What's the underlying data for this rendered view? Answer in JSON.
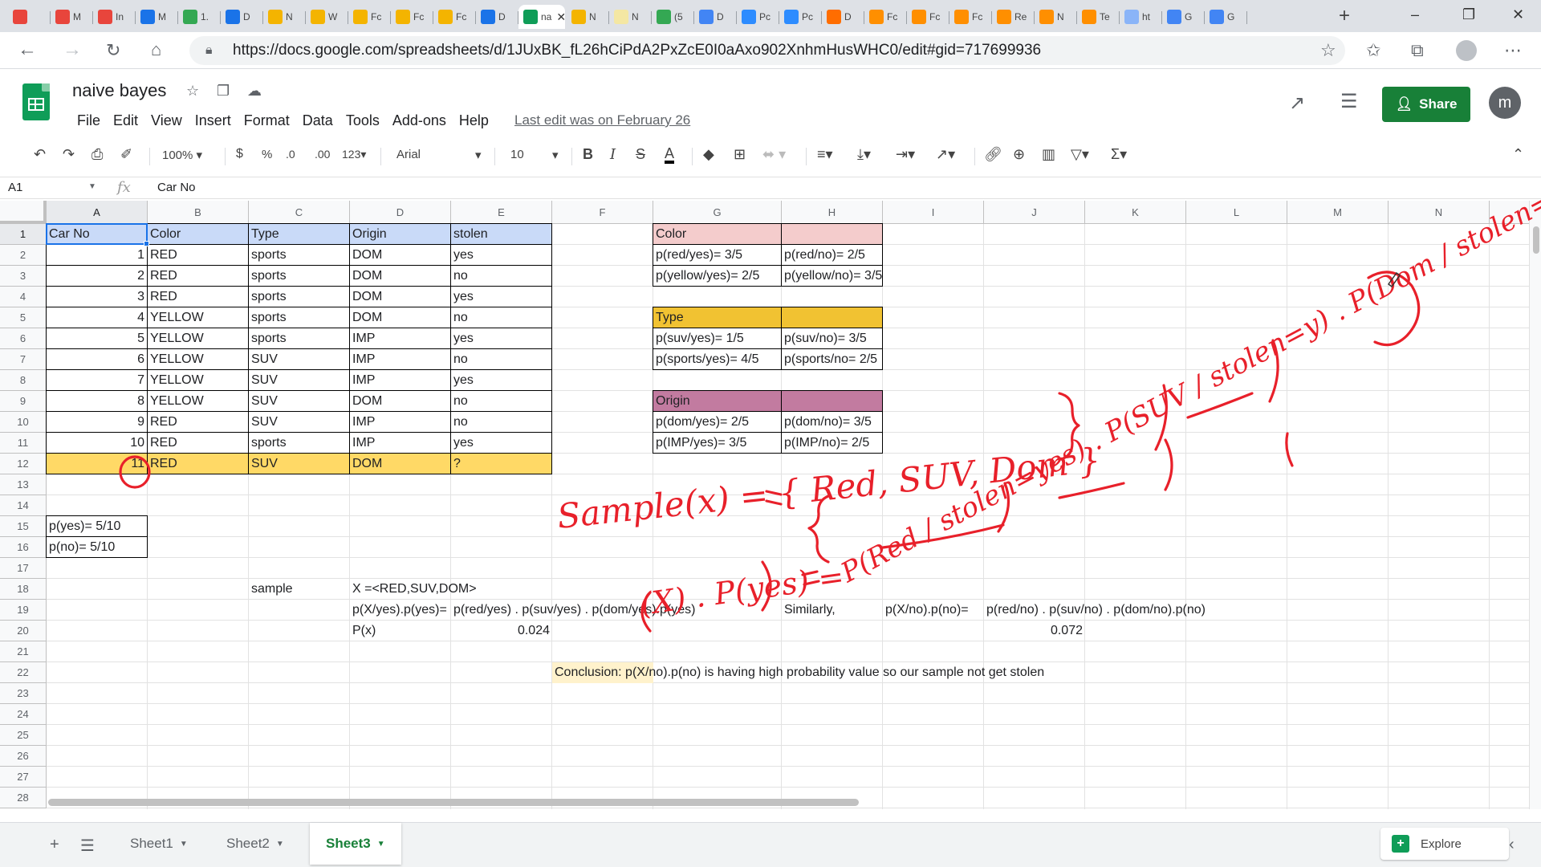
{
  "browser": {
    "tabs": [
      {
        "label": "",
        "color": "#e8453c",
        "icon": "gmail-icon"
      },
      {
        "label": "M",
        "color": "#e8453c",
        "icon": "gmail-icon"
      },
      {
        "label": "In",
        "color": "#e8453c",
        "icon": "gmail-icon"
      },
      {
        "label": "M",
        "color": "#1a73e8",
        "icon": "drive-icon"
      },
      {
        "label": "1.",
        "color": "#34a853",
        "icon": "plus-app-icon"
      },
      {
        "label": "D",
        "color": "#1a73e8",
        "icon": "drive-icon"
      },
      {
        "label": "N",
        "color": "#f4b400",
        "icon": "slides-icon"
      },
      {
        "label": "W",
        "color": "#f4b400",
        "icon": "slides-icon"
      },
      {
        "label": "Fc",
        "color": "#f4b400",
        "icon": "slides-icon"
      },
      {
        "label": "Fc",
        "color": "#f4b400",
        "icon": "slides-icon"
      },
      {
        "label": "Fc",
        "color": "#f4b400",
        "icon": "slides-icon"
      },
      {
        "label": "D",
        "color": "#1a73e8",
        "icon": "drive-icon"
      },
      {
        "label": "na",
        "color": "#0f9d58",
        "icon": "sheets-icon",
        "active": true
      },
      {
        "label": "N",
        "color": "#f4b400",
        "icon": "slides-icon"
      },
      {
        "label": "N",
        "color": "#f4e7a3",
        "icon": "keep-icon"
      },
      {
        "label": "(5",
        "color": "#34a853",
        "icon": "badge-icon"
      },
      {
        "label": "D",
        "color": "#4285f4",
        "icon": "link-icon"
      },
      {
        "label": "Pc",
        "color": "#2d8cff",
        "icon": "zoom-icon"
      },
      {
        "label": "Pc",
        "color": "#2d8cff",
        "icon": "zoom-icon"
      },
      {
        "label": "D",
        "color": "#ff6d00",
        "icon": "circle-icon"
      },
      {
        "label": "Fc",
        "color": "#ff8f00",
        "icon": "book-icon"
      },
      {
        "label": "Fc",
        "color": "#ff8f00",
        "icon": "book-icon"
      },
      {
        "label": "Fc",
        "color": "#ff8f00",
        "icon": "book-icon"
      },
      {
        "label": "Re",
        "color": "#ff8f00",
        "icon": "book-icon"
      },
      {
        "label": "N",
        "color": "#ff8f00",
        "icon": "book-icon"
      },
      {
        "label": "Te",
        "color": "#ff8f00",
        "icon": "book-icon"
      },
      {
        "label": "ht",
        "color": "#8ab4f8",
        "icon": "globe-icon"
      },
      {
        "label": "G",
        "color": "#4285f4",
        "icon": "google-icon"
      },
      {
        "label": "G",
        "color": "#4285f4",
        "icon": "google-icon"
      }
    ],
    "url": "https://docs.google.com/spreadsheets/d/1JUxBK_fL26hCiPdA2PxZcE0I0aAxo902XnhmHusWHC0/edit#gid=717699936"
  },
  "sheets": {
    "title": "naive bayes",
    "menu": [
      "File",
      "Edit",
      "View",
      "Insert",
      "Format",
      "Data",
      "Tools",
      "Add-ons",
      "Help"
    ],
    "last_edit": "Last edit was on February 26",
    "share_label": "Share",
    "avatar_letter": "m",
    "accent": "#188038"
  },
  "toolbar": {
    "zoom": "100%",
    "currency": "$",
    "percent": "%",
    "dec_less": ".0",
    "dec_more": ".00",
    "format_more": "123",
    "font": "Arial",
    "font_size": "10"
  },
  "formula_bar": {
    "cell_ref": "A1",
    "value": "Car No"
  },
  "grid": {
    "columns": [
      "A",
      "B",
      "C",
      "D",
      "E",
      "F",
      "G",
      "H",
      "I",
      "J",
      "K",
      "L",
      "M",
      "N"
    ],
    "rows": [
      "1",
      "2",
      "3",
      "4",
      "5",
      "6",
      "7",
      "8",
      "9",
      "10",
      "11",
      "12",
      "13",
      "14",
      "15",
      "16",
      "17",
      "18",
      "19",
      "20",
      "21",
      "22",
      "23",
      "24",
      "25",
      "26",
      "27",
      "28"
    ],
    "selected_cell": "A1",
    "header_fill": "#c9daf8",
    "highlight_fill": "#ffd966",
    "table": {
      "headers": [
        "Car No",
        "Color",
        "Type",
        "Origin",
        "stolen"
      ],
      "rows": [
        [
          "1",
          "RED",
          "sports",
          "DOM",
          "yes"
        ],
        [
          "2",
          "RED",
          "sports",
          "DOM",
          "no"
        ],
        [
          "3",
          "RED",
          "sports",
          "DOM",
          "yes"
        ],
        [
          "4",
          "YELLOW",
          "sports",
          "DOM",
          "no"
        ],
        [
          "5",
          "YELLOW",
          "sports",
          "IMP",
          "yes"
        ],
        [
          "6",
          "YELLOW",
          "SUV",
          "IMP",
          "no"
        ],
        [
          "7",
          "YELLOW",
          "SUV",
          "IMP",
          "yes"
        ],
        [
          "8",
          "YELLOW",
          "SUV",
          "DOM",
          "no"
        ],
        [
          "9",
          "RED",
          "SUV",
          "IMP",
          "no"
        ],
        [
          "10",
          "RED",
          "sports",
          "IMP",
          "yes"
        ],
        [
          "11",
          "RED",
          "SUV",
          "DOM",
          "?"
        ]
      ]
    },
    "priors": [
      "p(yes)= 5/10",
      "p(no)= 5/10"
    ],
    "color_table": {
      "title": "Color",
      "fill": "#f4cccc",
      "rows": [
        [
          "p(red/yes)= 3/5",
          "p(red/no)= 2/5"
        ],
        [
          "p(yellow/yes)= 2/5",
          "p(yellow/no)= 3/5"
        ]
      ]
    },
    "type_table": {
      "title": "Type",
      "fill": "#f1c232",
      "rows": [
        [
          "p(suv/yes)= 1/5",
          "p(suv/no)= 3/5"
        ],
        [
          "p(sports/yes)= 4/5",
          "p(sports/no= 2/5"
        ]
      ]
    },
    "origin_table": {
      "title": "Origin",
      "fill": "#c27ba0",
      "rows": [
        [
          "p(dom/yes)= 2/5",
          "p(dom/no)= 3/5"
        ],
        [
          "p(IMP/yes)= 3/5",
          "p(IMP/no)= 2/5"
        ]
      ]
    },
    "sample": {
      "label": "sample",
      "x_value": "X =<RED,SUV,DOM>",
      "pyes_label": "p(X/yes).p(yes)=",
      "pyes_formula": "p(red/yes) . p(suv/yes) . p(dom/yes).p(yes)",
      "px_label": "P(x)",
      "pyes_value": "0.024",
      "similarly": "Similarly,",
      "pno_label": "p(X/no).p(no)=",
      "pno_formula": "p(red/no) . p(suv/no) . p(dom/no).p(no)",
      "pno_value": "0.072"
    },
    "conclusion": "Conclusion: p(X/no).p(no) is having high probability value so our sample not get stolen",
    "conclusion_fill": "#fff2cc"
  },
  "annotations": {
    "ink_color": "#e8202a",
    "line1": "Sample(x) = { Red, SUV, Dom }",
    "line2": "P(Red / stolen=yes) . P(SUV / stolen=y) . P(Dom / stolen=y) . P(yes)",
    "line3": "(X) . P(yes) ="
  },
  "sheet_tabs": {
    "tabs": [
      "Sheet1",
      "Sheet2",
      "Sheet3"
    ],
    "active": "Sheet3",
    "explore_label": "Explore"
  }
}
